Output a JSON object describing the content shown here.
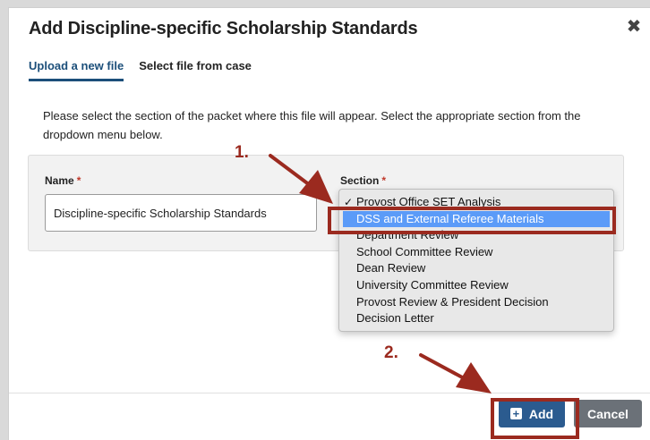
{
  "dialog": {
    "title": "Add Discipline-specific Scholarship Standards",
    "close_glyph": "✖"
  },
  "tabs": [
    {
      "label": "Upload a new file",
      "active": true
    },
    {
      "label": "Select file from case",
      "active": false
    }
  ],
  "instructions": "Please select the section of the packet where this file will appear. Select the appropriate section from the dropdown menu below.",
  "form": {
    "name_label": "Name",
    "name_value": "Discipline-specific Scholarship Standards",
    "section_label": "Section",
    "required_marker": "*"
  },
  "section_dropdown": {
    "checkmark": "✓",
    "options": [
      {
        "label": "Provost Office SET Analysis",
        "checked": true
      },
      {
        "label": "DSS and External Referee Materials",
        "highlighted": true
      },
      {
        "label": "Department Review"
      },
      {
        "label": "School Committee Review"
      },
      {
        "label": "Dean Review"
      },
      {
        "label": "University Committee Review"
      },
      {
        "label": "Provost Review & President Decision"
      },
      {
        "label": "Decision Letter"
      }
    ]
  },
  "footer": {
    "add_label": "Add",
    "cancel_label": "Cancel"
  },
  "annotations": {
    "step1": "1.",
    "step2": "2.",
    "color": "#9b2a1f"
  },
  "colors": {
    "primary": "#2b5b8f",
    "tab_active": "#1c4f7a",
    "highlight": "#5b9bf8",
    "cancel": "#6b7178"
  },
  "icons": {
    "close": "close-icon",
    "add": "plus-square-icon",
    "check": "checkmark-icon"
  }
}
